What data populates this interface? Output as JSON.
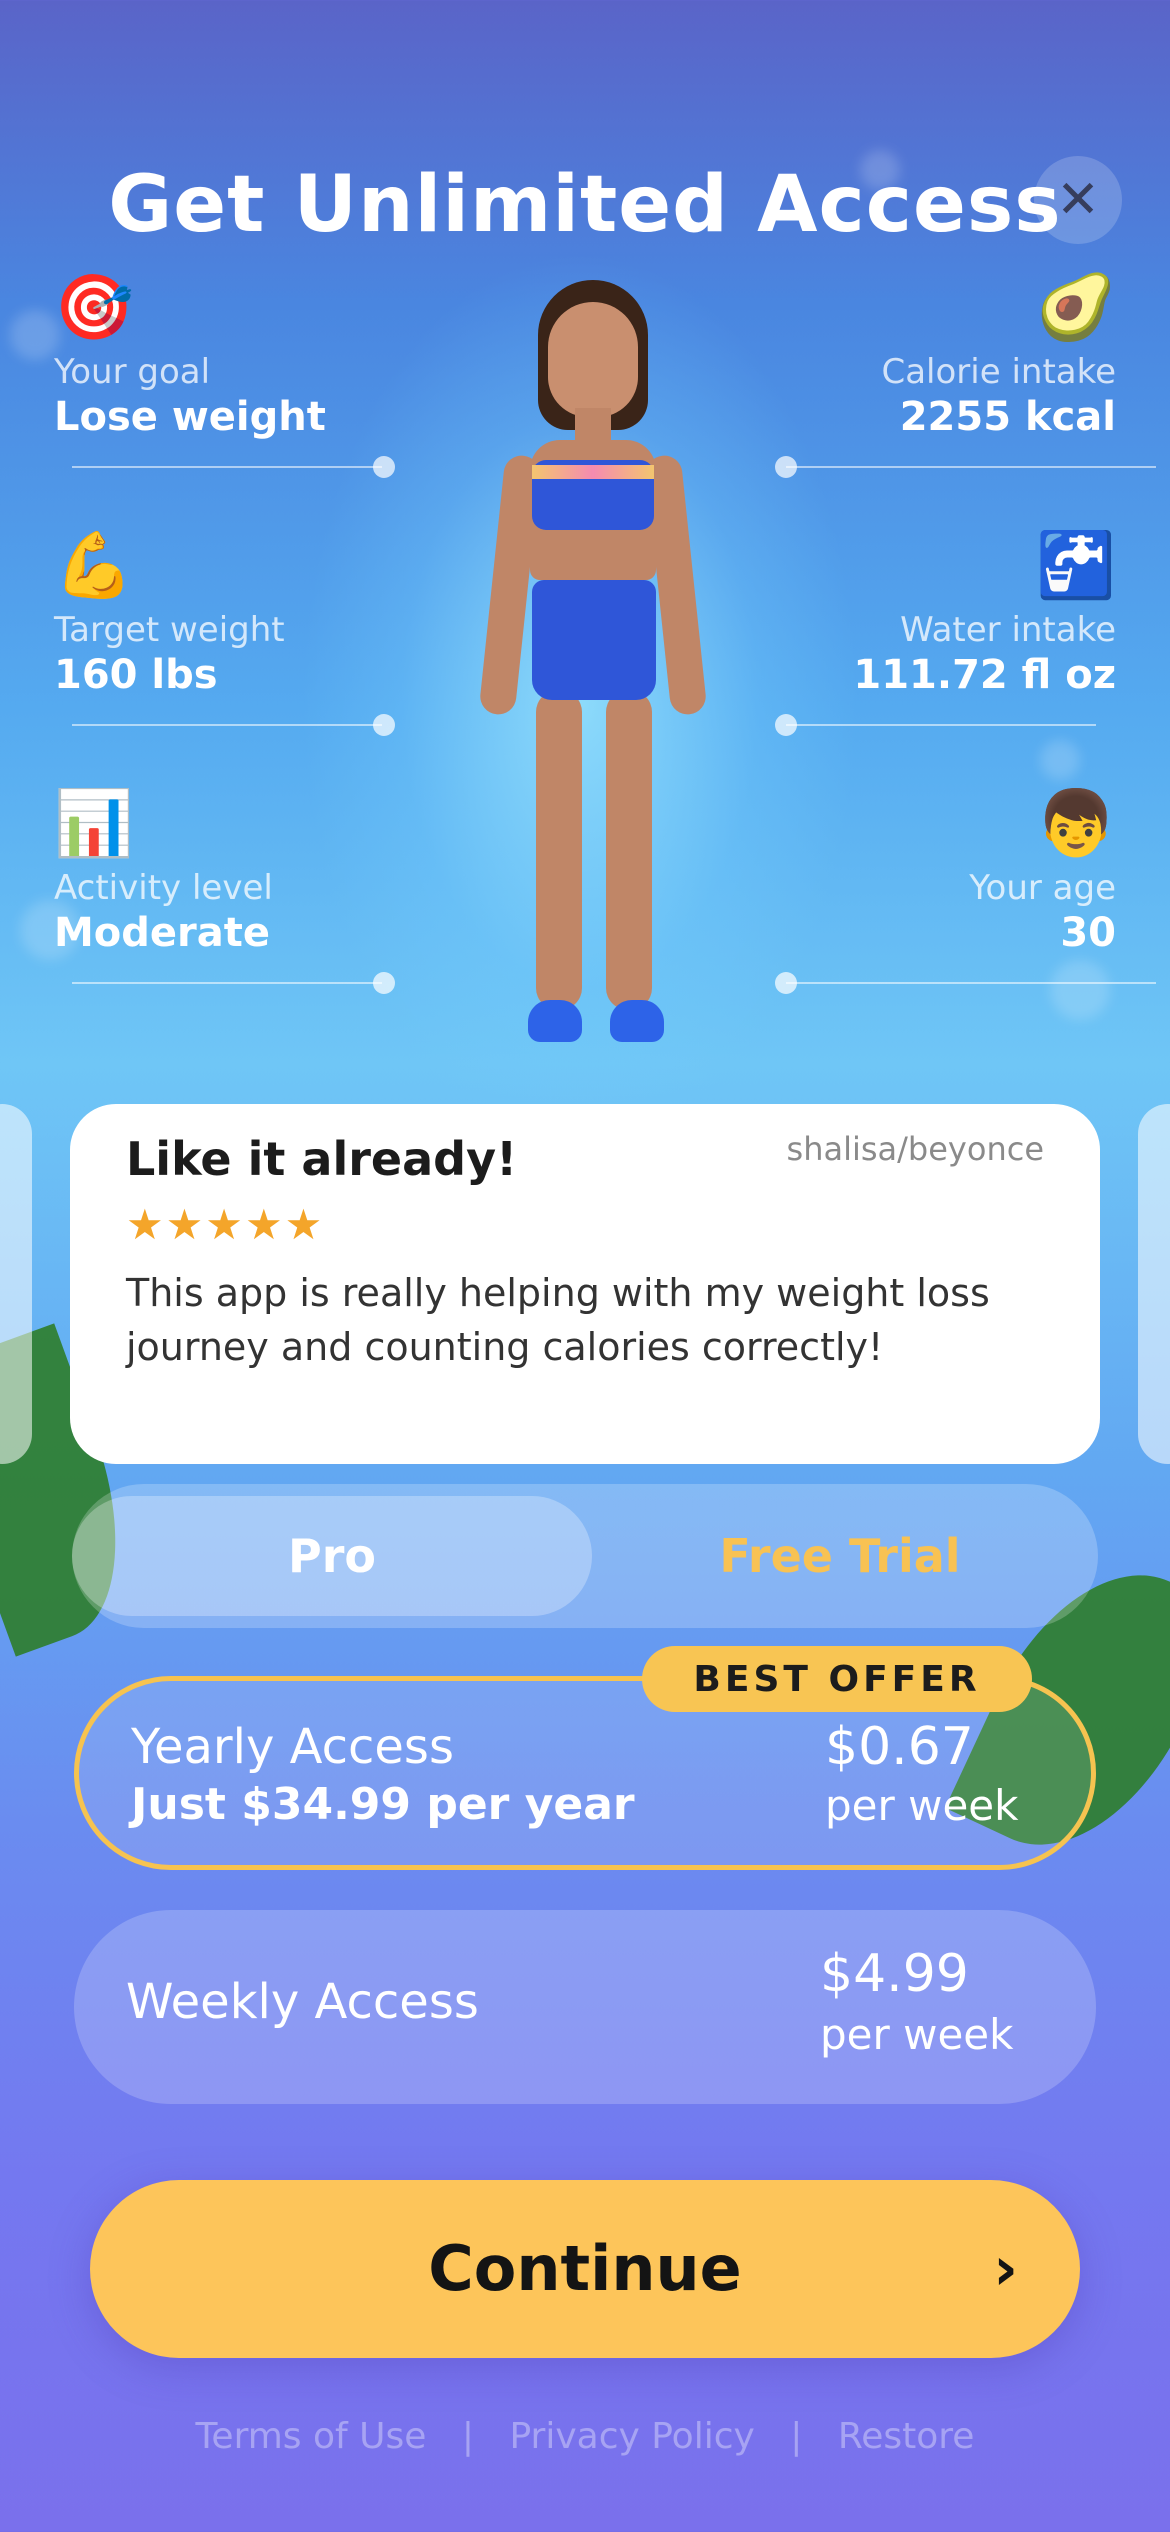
{
  "header": {
    "title": "Get Unlimited Access",
    "close_icon": "close-icon",
    "close_glyph": "✕"
  },
  "stats": [
    {
      "icon": "target-icon",
      "emoji": "🎯",
      "label": "Your goal",
      "value": "Lose weight"
    },
    {
      "icon": "avocado-icon",
      "emoji": "🥑",
      "label": "Calorie intake",
      "value": "2255 kcal"
    },
    {
      "icon": "flexed-biceps-icon",
      "emoji": "💪",
      "label": "Target weight",
      "value": "160 lbs"
    },
    {
      "icon": "water-tap-icon",
      "emoji": "🚰",
      "label": "Water intake",
      "value": "111.72 fl oz"
    },
    {
      "icon": "bar-chart-icon",
      "emoji": "📊",
      "label": "Activity level",
      "value": "Moderate"
    },
    {
      "icon": "boy-icon",
      "emoji": "👦",
      "label": "Your age",
      "value": "30"
    }
  ],
  "review": {
    "title": "Like it already!",
    "author": "shalisa/beyonce",
    "stars": "★★★★★",
    "rating": 5,
    "text": "This app is really helping with my weight loss journey and counting calories correctly!"
  },
  "segments": {
    "pro": "Pro",
    "free_trial": "Free Trial",
    "selected": "Pro"
  },
  "plans": {
    "badge": "BEST OFFER",
    "yearly": {
      "name": "Yearly Access",
      "subtitle": "Just $34.99 per year",
      "price": "$0.67",
      "unit": "per week"
    },
    "weekly": {
      "name": "Weekly Access",
      "price": "$4.99",
      "unit": "per week"
    }
  },
  "cta": {
    "label": "Continue",
    "arrow": "›",
    "arrow_icon": "chevron-right-icon"
  },
  "footer": {
    "terms": "Terms of Use",
    "privacy": "Privacy Policy",
    "restore": "Restore",
    "separator": "|"
  },
  "colors": {
    "accent": "#fdc55a",
    "star": "#f4a52a",
    "free_trial_text": "#f8c253",
    "badge": "#f8c553"
  }
}
